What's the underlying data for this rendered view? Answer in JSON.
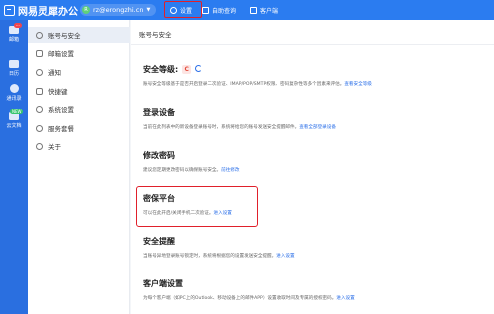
{
  "topbar": {
    "brand": "网易灵犀办公",
    "account": "rz@erongzhi.cn",
    "account_initial": "R",
    "nav": [
      {
        "label": "设置",
        "icon": "gear-icon"
      },
      {
        "label": "自助查询",
        "icon": "document-icon"
      },
      {
        "label": "客户端",
        "icon": "monitor-icon"
      }
    ]
  },
  "rail": {
    "items": [
      {
        "label": "邮箱",
        "badge": "···",
        "icon": "mail-icon"
      },
      {
        "label": "日历",
        "badge": "",
        "icon": "calendar-icon"
      },
      {
        "label": "通讯录",
        "badge": "",
        "icon": "contacts-icon"
      },
      {
        "label": "云文档",
        "badge": "NEW",
        "icon": "cloud-doc-icon"
      }
    ]
  },
  "sidenav": {
    "items": [
      {
        "label": "账号与安全",
        "icon": "user-icon",
        "active": true
      },
      {
        "label": "邮箱设置",
        "icon": "mail-icon",
        "active": false
      },
      {
        "label": "通知",
        "icon": "bell-icon",
        "active": false
      },
      {
        "label": "快捷键",
        "icon": "keyboard-icon",
        "active": false
      },
      {
        "label": "系统设置",
        "icon": "gear-icon",
        "active": false
      },
      {
        "label": "服务套餐",
        "icon": "package-icon",
        "active": false
      },
      {
        "label": "关于",
        "icon": "info-icon",
        "active": false
      }
    ]
  },
  "main": {
    "breadcrumb": "账号与安全",
    "sections": {
      "security": {
        "title": "安全等级:",
        "level": "C",
        "desc": "账号安全等级基于是否开启登录二次验证、IMAP/POP/SMTP权限、密码复杂性等多个因素来评估。",
        "link": "查看安全等级"
      },
      "login": {
        "title": "登录设备",
        "desc": "当前在此列表中的新设备登录账号时，系统将给您的账号发送安全提醒邮件。",
        "link": "查看全部登录设备"
      },
      "password": {
        "title": "修改密码",
        "desc": "建议您定期更改密码以确保账号安全。",
        "link": "前往修改"
      },
      "secpwd": {
        "title": "密保平台",
        "desc": "可以在此开启/关闭手机二次验证。",
        "link": "进入设置"
      },
      "alert": {
        "title": "安全提醒",
        "desc": "当账号异地登录账号锁定时，系统将根据您的设置发送安全提醒。",
        "link": "进入设置"
      },
      "client": {
        "title": "客户端设置",
        "desc": "为每个客户端（如PC上的Outlook、移动设备上的邮件APP）设置收取时间及专属的授权密码。",
        "link": "进入设置"
      }
    }
  }
}
